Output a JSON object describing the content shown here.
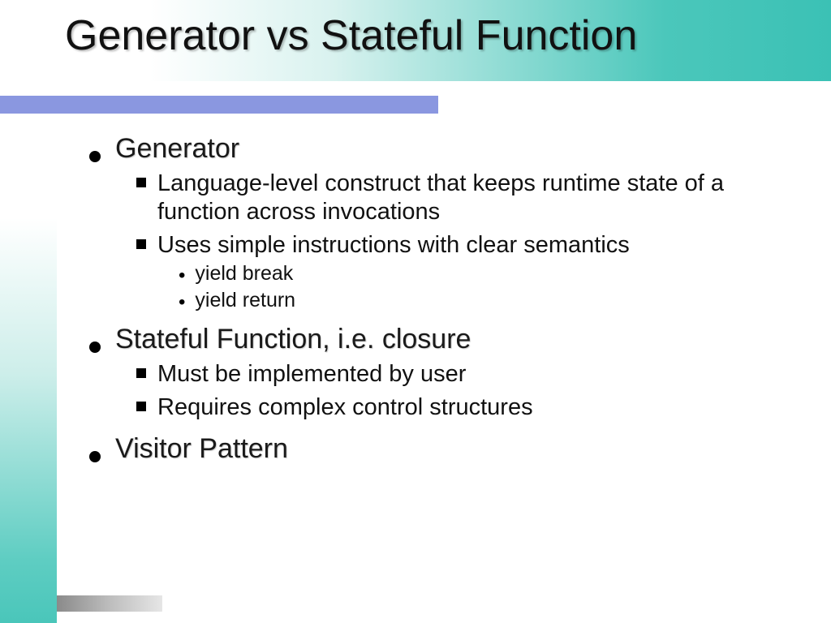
{
  "title": "Generator vs Stateful Function",
  "sections": [
    {
      "heading": "Generator",
      "sub": [
        {
          "text": "Language-level construct that keeps runtime state of a function across invocations"
        },
        {
          "text": "Uses simple instructions with clear semantics",
          "sub": [
            {
              "text": "yield break"
            },
            {
              "text": "yield return"
            }
          ]
        }
      ]
    },
    {
      "heading": "Stateful Function, i.e. closure",
      "sub": [
        {
          "text": "Must be implemented by user"
        },
        {
          "text": "Requires complex control structures"
        }
      ]
    },
    {
      "heading": "Visitor Pattern"
    }
  ]
}
